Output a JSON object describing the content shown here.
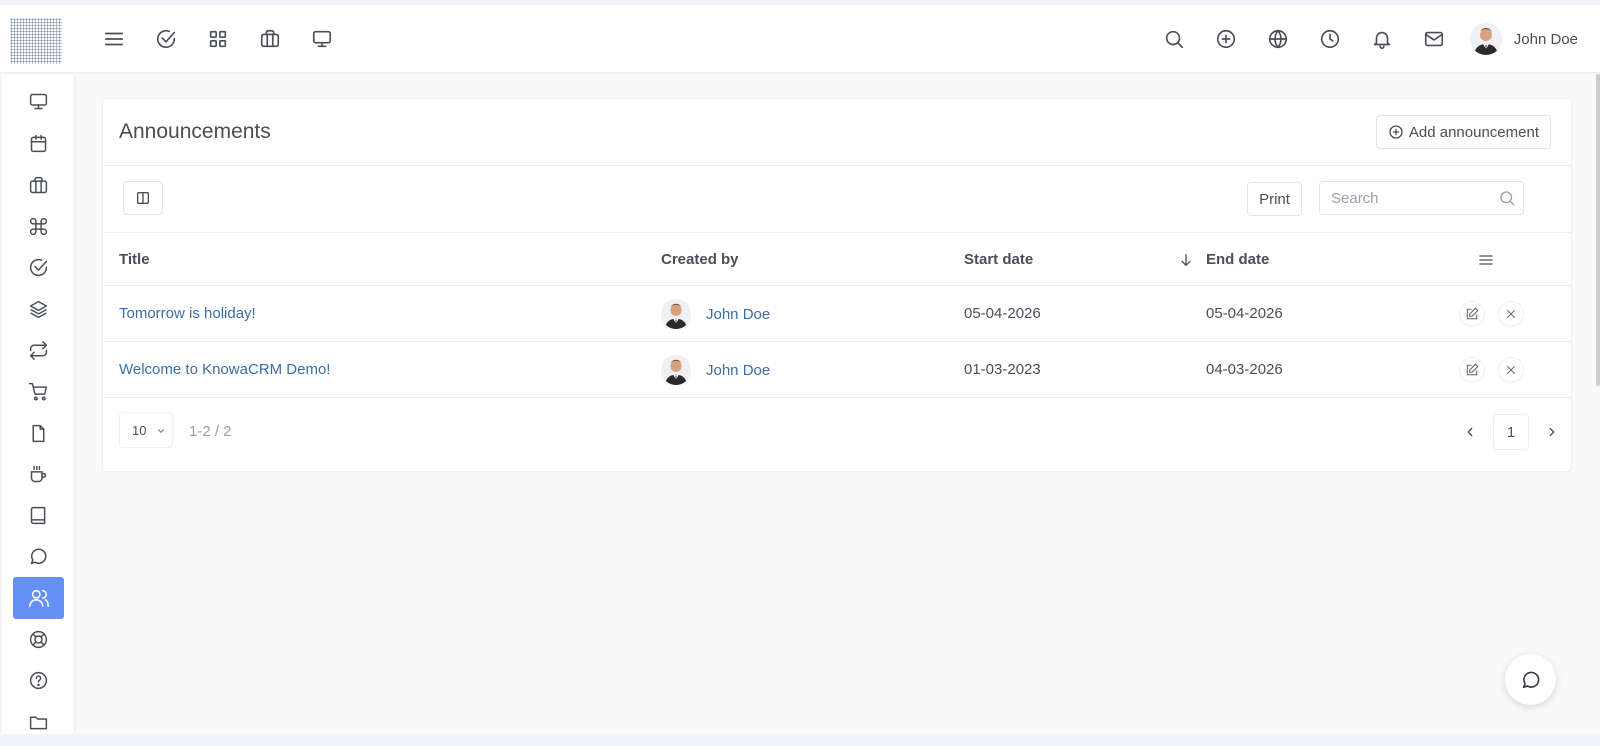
{
  "header": {
    "user_name": "John Doe"
  },
  "page": {
    "title": "Announcements",
    "add_button_label": "Add announcement"
  },
  "toolbar": {
    "print_label": "Print",
    "search_placeholder": "Search"
  },
  "table": {
    "columns": [
      "Title",
      "Created by",
      "Start date",
      "End date"
    ],
    "rows": [
      {
        "title": "Tomorrow is holiday!",
        "created_by": "John Doe",
        "start_date": "05-04-2026",
        "end_date": "05-04-2026"
      },
      {
        "title": "Welcome to KnowaCRM Demo!",
        "created_by": "John Doe",
        "start_date": "01-03-2023",
        "end_date": "04-03-2026"
      }
    ]
  },
  "pagination": {
    "page_size": "10",
    "range": "1-2 / 2",
    "current_page": "1"
  },
  "colors": {
    "accent": "#6690f4",
    "link": "#3b6ea5"
  }
}
